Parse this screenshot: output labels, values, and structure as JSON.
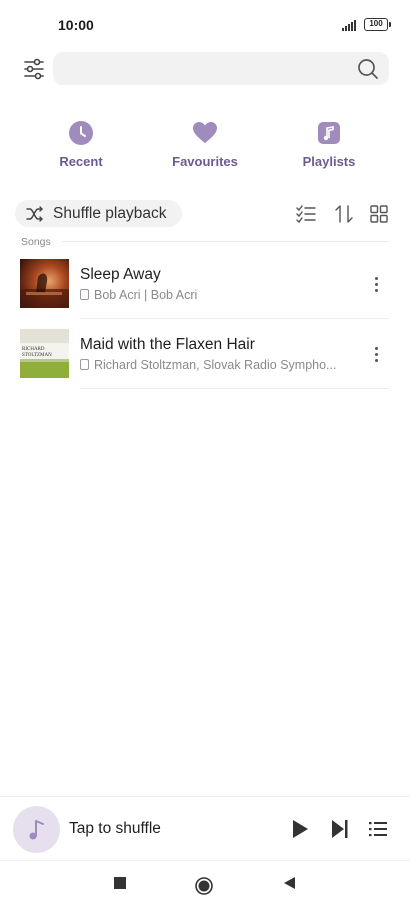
{
  "status_bar": {
    "time": "10:00",
    "battery": "100"
  },
  "search": {
    "placeholder": "",
    "value": ""
  },
  "categories": [
    {
      "label": "Recent",
      "icon": "clock-icon"
    },
    {
      "label": "Favourites",
      "icon": "heart-icon"
    },
    {
      "label": "Playlists",
      "icon": "music-note-icon"
    }
  ],
  "toolbar": {
    "shuffle_label": "Shuffle playback"
  },
  "section": {
    "label": "Songs"
  },
  "songs": [
    {
      "title": "Sleep Away",
      "subtitle": "Bob Acri | Bob Acri"
    },
    {
      "title": "Maid with the Flaxen Hair",
      "subtitle": "Richard Stoltzman, Slovak Radio Sympho..."
    }
  ],
  "album_art": {
    "artist_line1": "RICHARD",
    "artist_line2": "STOLTZMAN"
  },
  "player": {
    "label": "Tap to shuffle"
  },
  "colors": {
    "accent": "#a08bbd",
    "accent_text": "#6e5a8f",
    "surface": "#f2f2f3"
  }
}
